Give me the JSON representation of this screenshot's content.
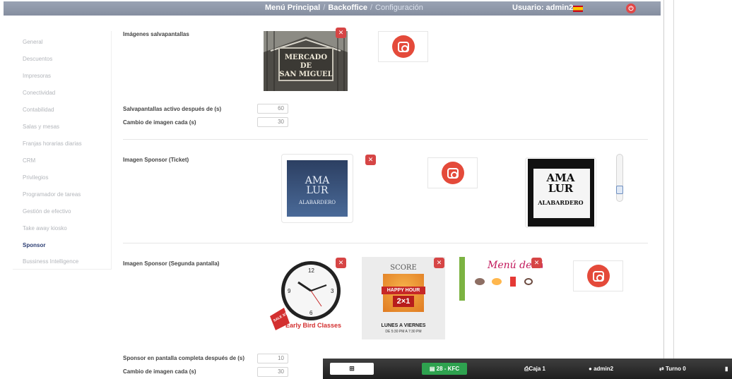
{
  "header": {
    "crumb1": "Menú Principal",
    "crumb2": "Backoffice",
    "crumb3": "Configuración",
    "user": "Usuario: admin2",
    "sep": "/"
  },
  "sidebar": {
    "items": [
      {
        "label": "General"
      },
      {
        "label": "Descuentos"
      },
      {
        "label": "Impresoras"
      },
      {
        "label": "Conectividad"
      },
      {
        "label": "Contabilidad"
      },
      {
        "label": "Salas y mesas"
      },
      {
        "label": "Franjas horarias diarias"
      },
      {
        "label": "CRM"
      },
      {
        "label": "Privilegios"
      },
      {
        "label": "Programador de tareas"
      },
      {
        "label": "Gestión de efectivo"
      },
      {
        "label": "Take away kiosko"
      },
      {
        "label": "Sponsor",
        "active": true
      },
      {
        "label": "Bussiness Intelligence"
      }
    ]
  },
  "screensaver": {
    "title": "Imágenes salvapantallas",
    "active_after_label": "Salvapantallas activo después de (s)",
    "active_after_value": "60",
    "change_every_label": "Cambio de imagen cada (s)",
    "change_every_value": "30",
    "image1_text": [
      "MERCADO",
      "DE",
      "SAN MIGUEL"
    ]
  },
  "ticket_sponsor": {
    "title": "Imagen Sponsor (Ticket)",
    "logo_text": [
      "AMA",
      "LUR",
      "ALABARDERO"
    ],
    "slider_value": 0.7
  },
  "second_screen": {
    "title": "Imagen Sponsor (Segunda pantalla)",
    "fullscreen_after_label": "Sponsor en pantalla completa después de (s)",
    "fullscreen_after_value": "10",
    "change_every_label": "Cambio de imagen cada (s)",
    "change_every_value": "30",
    "clock_caption": "Early Bird Classes",
    "clock_badge": "SALE 3/12",
    "score_title": "SCORE",
    "score_banner": "HAPPY HOUR",
    "score_offer": "2×1",
    "score_days": "LUNES A VIERNES",
    "score_hours": "DE 5:30 PM A 7:30 PM",
    "menu_title": "Menú del día"
  },
  "taskbar": {
    "grid_icon": "⊞",
    "store": "28 - KFC",
    "caja": "Caja 1",
    "user": "admin2",
    "turno": "Turno 0"
  },
  "colors": {
    "header": "#8b94a6",
    "delete": "#d64545",
    "instagram": "#e44a3a",
    "active_link": "#2c3e73",
    "store_badge": "#2ea24f"
  }
}
